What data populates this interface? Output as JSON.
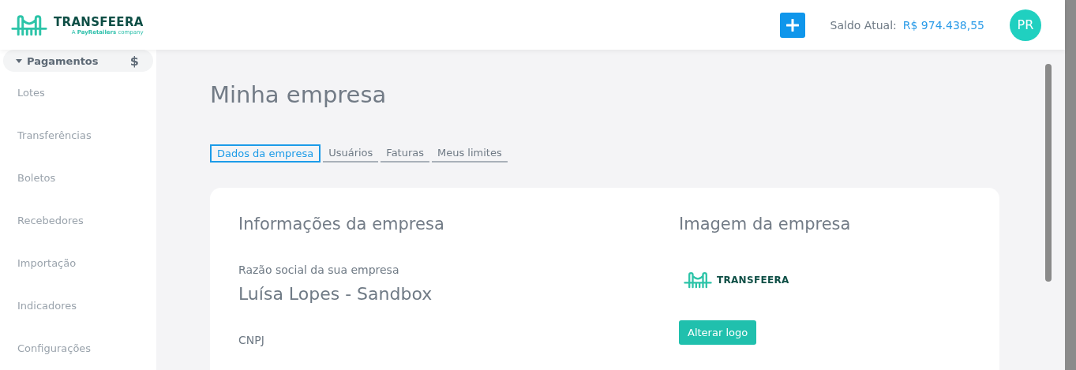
{
  "header": {
    "brand": "TRANSFEERA",
    "brand_tagline": "A **PayRetailers** company",
    "balance_label": "Saldo Atual:",
    "balance_value": "R$ 974.438,55",
    "avatar": "PR"
  },
  "sidebar": {
    "group": {
      "label": "Pagamentos",
      "icon": "$",
      "expanded": true
    },
    "items": [
      {
        "label": "Lotes",
        "selected": false
      },
      {
        "label": "Transferências",
        "selected": false
      },
      {
        "label": "Boletos",
        "selected": false
      },
      {
        "label": "Recebedores",
        "selected": false
      },
      {
        "label": "Importação",
        "selected": false
      },
      {
        "label": "Indicadores",
        "selected": false
      },
      {
        "label": "Configurações",
        "selected": false
      }
    ]
  },
  "page": {
    "title": "Minha empresa",
    "tabs": [
      {
        "label": "Dados da empresa",
        "selected": true
      },
      {
        "label": "Usuários",
        "selected": false
      },
      {
        "label": "Faturas",
        "selected": false
      },
      {
        "label": "Meus limites",
        "selected": false
      }
    ],
    "info": {
      "heading": "Informações da empresa",
      "fields": [
        {
          "label": "Razão social da sua empresa",
          "value": "Luísa Lopes - Sandbox"
        },
        {
          "label": "CNPJ"
        }
      ]
    },
    "image": {
      "heading": "Imagem da empresa",
      "logo_text": "TRANSFEERA",
      "button": "Alterar logo"
    }
  }
}
